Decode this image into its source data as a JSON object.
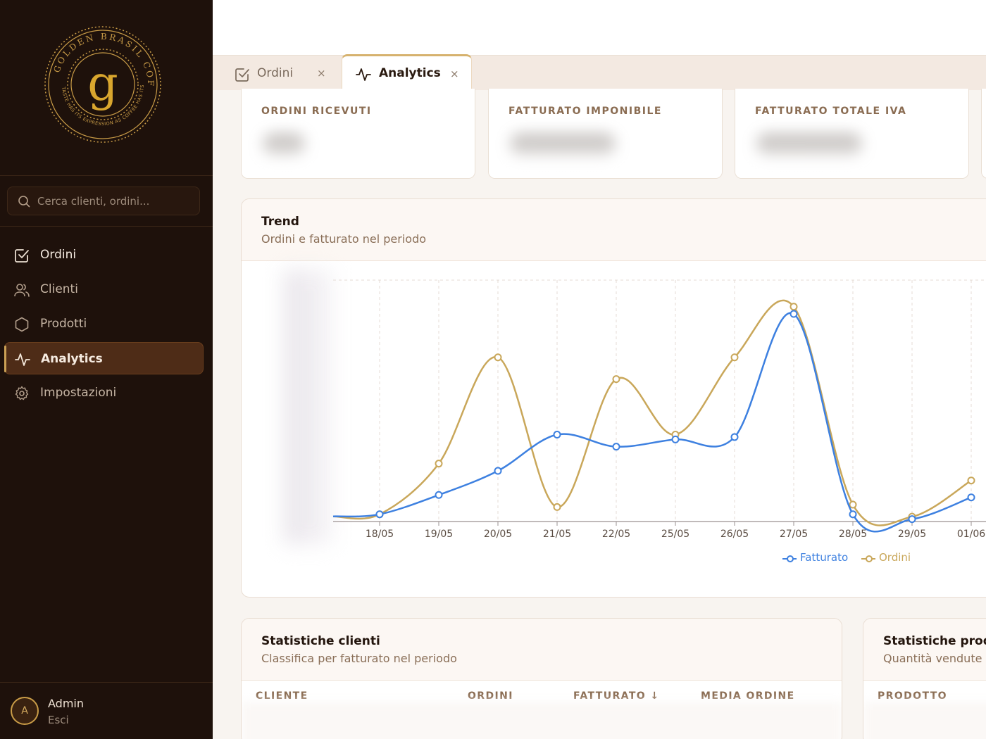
{
  "brand": {
    "logo_ring_text": "GOLDEN BRASIL COFFEE",
    "logo_inner_text": "TASTE HAS ITS EXPRESSION AS COFFEE HAS ITS OWN",
    "logo_letter": "g",
    "colors": {
      "gold": "#caa055",
      "dark": "#1e110b"
    }
  },
  "search": {
    "placeholder": "Cerca clienti, ordini..."
  },
  "nav": [
    {
      "label": "Ordini",
      "icon": "check-square-icon"
    },
    {
      "label": "Clienti",
      "icon": "users-icon"
    },
    {
      "label": "Prodotti",
      "icon": "hexagon-icon"
    },
    {
      "label": "Analytics",
      "icon": "activity-icon",
      "active": true
    },
    {
      "label": "Impostazioni",
      "icon": "gear-icon"
    }
  ],
  "user": {
    "avatar_letter": "A",
    "name": "Admin",
    "logout": "Esci"
  },
  "tabs": [
    {
      "label": "Ordini",
      "close": "×",
      "active": false
    },
    {
      "label": "Analytics",
      "close": "×",
      "active": true
    }
  ],
  "stats": [
    {
      "label": "ORDINI RICEVUTI"
    },
    {
      "label": "FATTURATO IMPONIBILE"
    },
    {
      "label": "FATTURATO TOTALE IVA"
    }
  ],
  "trend": {
    "title": "Trend",
    "subtitle": "Ordini e fatturato nel periodo"
  },
  "chart_data": {
    "type": "line",
    "x": [
      "18/05",
      "19/05",
      "20/05",
      "21/05",
      "22/05",
      "25/05",
      "26/05",
      "27/05",
      "28/05",
      "29/05",
      "01/06"
    ],
    "series": [
      {
        "name": "Fatturato",
        "color": "#3d80e0",
        "values": [
          0.03,
          0.11,
          0.21,
          0.36,
          0.31,
          0.34,
          0.35,
          0.86,
          0.03,
          0.01,
          0.1
        ]
      },
      {
        "name": "Ordini",
        "color": "#c9a75a",
        "values": [
          0.03,
          0.24,
          0.68,
          0.06,
          0.59,
          0.36,
          0.68,
          0.89,
          0.07,
          0.02,
          0.17
        ]
      }
    ],
    "y_axis_labels_visible": false,
    "grid": "dashed vertical",
    "legend_position": "bottom-right"
  },
  "clients": {
    "title": "Statistiche clienti",
    "subtitle": "Classifica per fatturato nel periodo",
    "columns": [
      "CLIENTE",
      "ORDINI",
      "FATTURATO",
      "MEDIA ORDINE"
    ],
    "sort_indicator": "↓"
  },
  "products": {
    "title": "Statistiche prod",
    "subtitle": "Quantità vendute r",
    "columns": [
      "PRODOTTO"
    ]
  }
}
